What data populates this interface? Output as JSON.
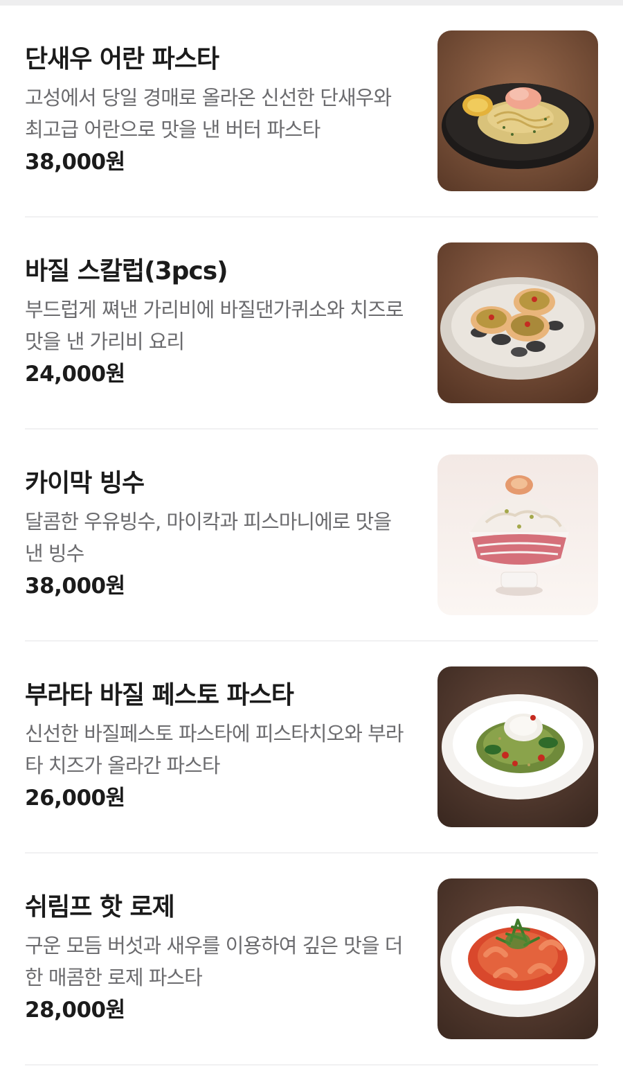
{
  "menu": {
    "items": [
      {
        "name": "단새우 어란 파스타",
        "description": "고성에서 당일 경매로 올라온 신선한 단새우와 최고급 어란으로 맛을 낸 버터 파스타",
        "price": "38,000원",
        "image_icon": "shrimp-pasta-photo"
      },
      {
        "name": "바질 스칼럽(3pcs)",
        "description": "부드럽게 쪄낸 가리비에 바질댄가퀴소와 치즈로 맛을 낸 가리비 요리",
        "price": "24,000원",
        "image_icon": "scallop-dish-photo"
      },
      {
        "name": "카이막 빙수",
        "description": "달콤한 우유빙수, 마이칵과 피스마니에로 맛을 낸 빙수",
        "price": "38,000원",
        "image_icon": "bingsu-photo"
      },
      {
        "name": "부라타 바질 페스토 파스타",
        "description": "신선한 바질페스토 파스타에 피스타치오와 부라타 치즈가 올라간 파스타",
        "price": "26,000원",
        "image_icon": "pesto-pasta-photo"
      },
      {
        "name": "쉬림프 핫 로제",
        "description": "구운 모듬 버섯과 새우를 이용하여 깊은 맛을 더한 매콤한 로제 파스타",
        "price": "28,000원",
        "image_icon": "rose-pasta-photo"
      }
    ]
  },
  "colors": {
    "background": "#ffffff",
    "title": "#1b1b1b",
    "description": "#6b6b6e",
    "divider": "#f1f1f2"
  }
}
